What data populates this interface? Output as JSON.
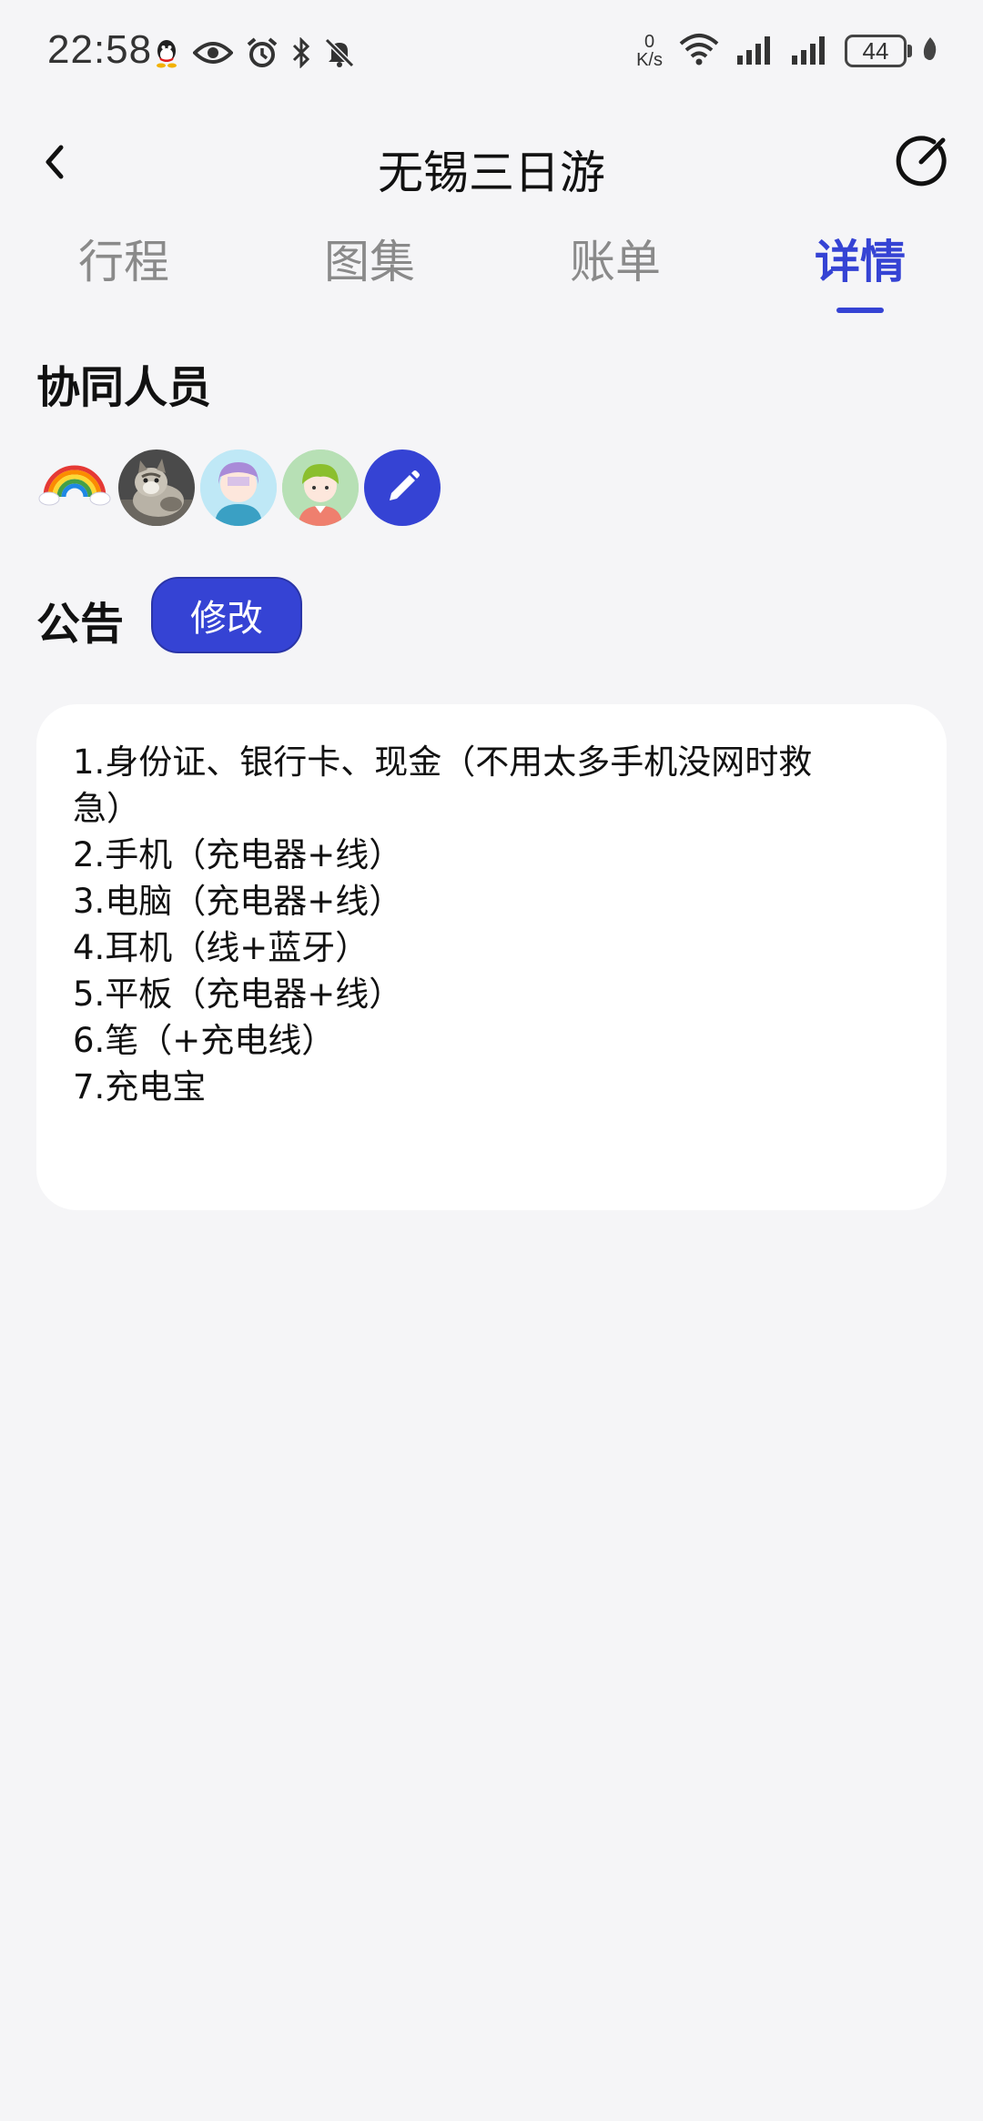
{
  "status_bar": {
    "time": "22:58",
    "net_speed_value": "0",
    "net_speed_unit": "K/s",
    "battery": "44"
  },
  "header": {
    "title": "无锡三日游"
  },
  "tabs": [
    {
      "label": "行程",
      "active": false
    },
    {
      "label": "图集",
      "active": false
    },
    {
      "label": "账单",
      "active": false
    },
    {
      "label": "详情",
      "active": true
    }
  ],
  "collaborators": {
    "title": "协同人员",
    "avatars": [
      "rainbow",
      "cat-photo",
      "purple-hair-avatar",
      "green-hair-avatar"
    ]
  },
  "notice": {
    "title": "公告",
    "edit_label": "修改",
    "lines": [
      "1.身份证、银行卡、现金（不用太多手机没网时救",
      "急）",
      "2.手机（充电器+线）",
      "3.电脑（充电器+线）",
      "4.耳机（线+蓝牙）",
      "5.平板（充电器+线）",
      "6.笔（+充电线）",
      "7.充电宝"
    ]
  },
  "colors": {
    "accent": "#3543d4",
    "background": "#f5f5f7",
    "card": "#ffffff",
    "tab_inactive": "#8a8a8a"
  }
}
